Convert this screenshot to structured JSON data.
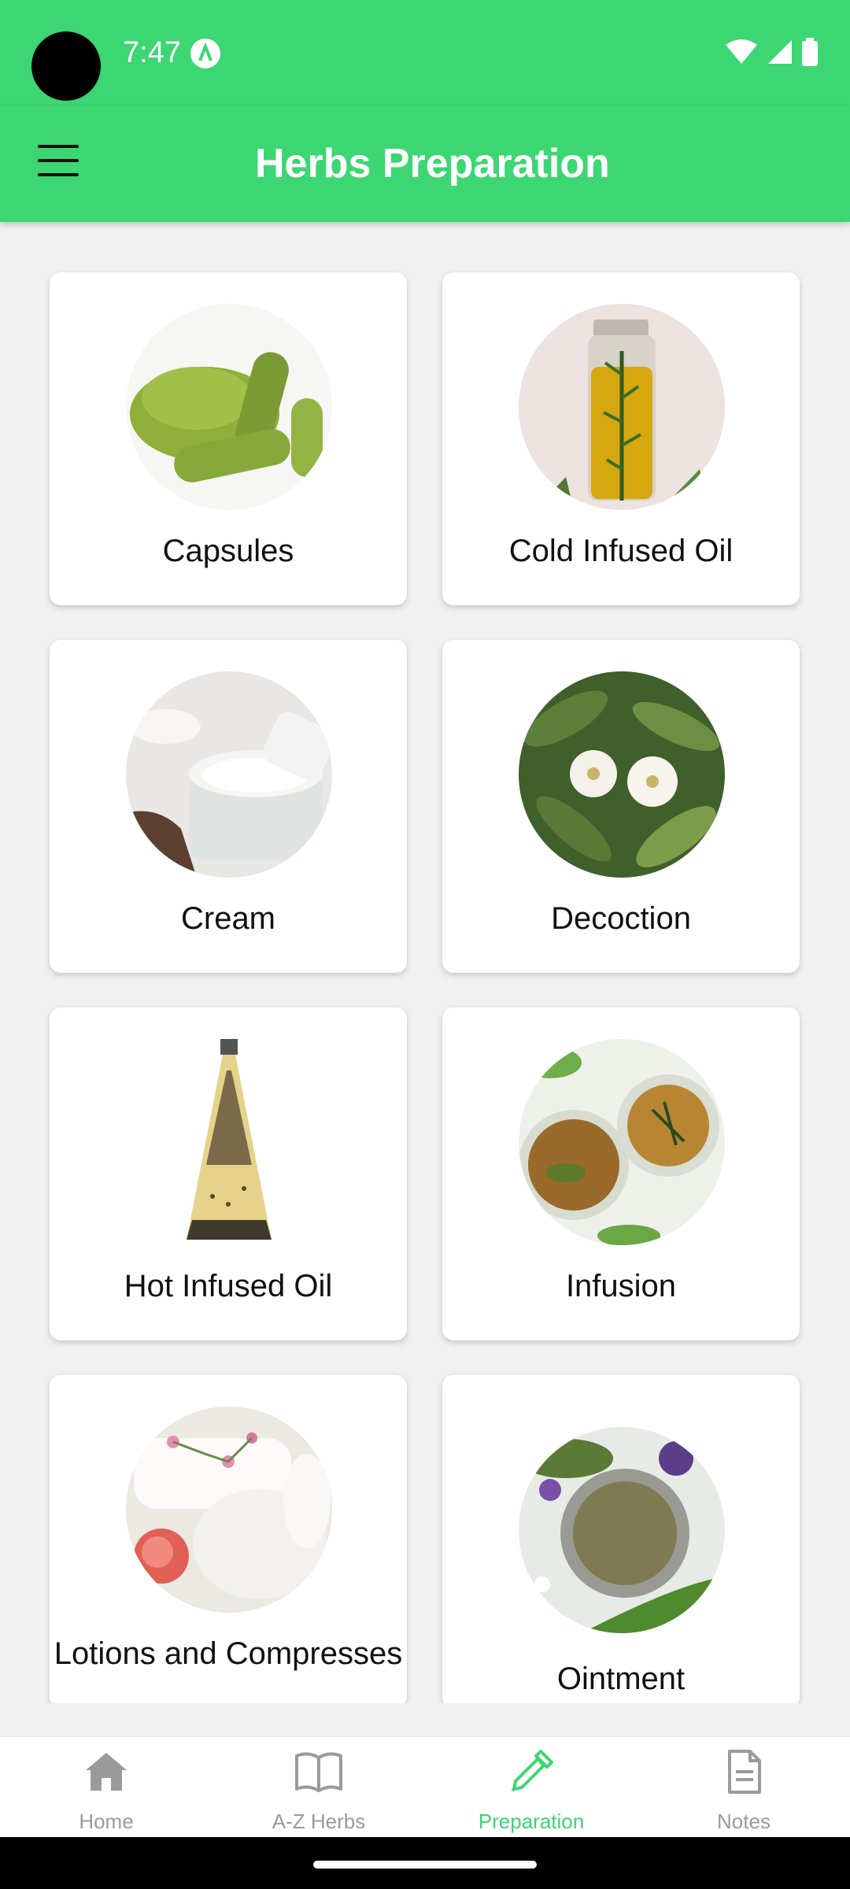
{
  "status": {
    "time": "7:47"
  },
  "appbar": {
    "title": "Herbs Preparation"
  },
  "cards": [
    {
      "label": "Capsules",
      "image": "capsules-photo"
    },
    {
      "label": "Cold Infused Oil",
      "image": "oil-bottle-photo"
    },
    {
      "label": "Cream",
      "image": "cream-jar-photo"
    },
    {
      "label": "Decoction",
      "image": "magnolia-flowers-photo"
    },
    {
      "label": "Hot Infused Oil",
      "image": "cone-bottle-photo"
    },
    {
      "label": "Infusion",
      "image": "tea-cups-photo"
    },
    {
      "label": "Lotions and Compresses",
      "image": "herbal-compress-photo"
    },
    {
      "label": "Ointment",
      "image": "ointment-tin-photo"
    }
  ],
  "nav": {
    "home": "Home",
    "az": "A-Z Herbs",
    "prep": "Preparation",
    "notes": "Notes",
    "active": "Preparation"
  },
  "colors": {
    "accent": "#3cd672",
    "inactive": "#9a9a9a",
    "background": "#f1f1f1"
  }
}
